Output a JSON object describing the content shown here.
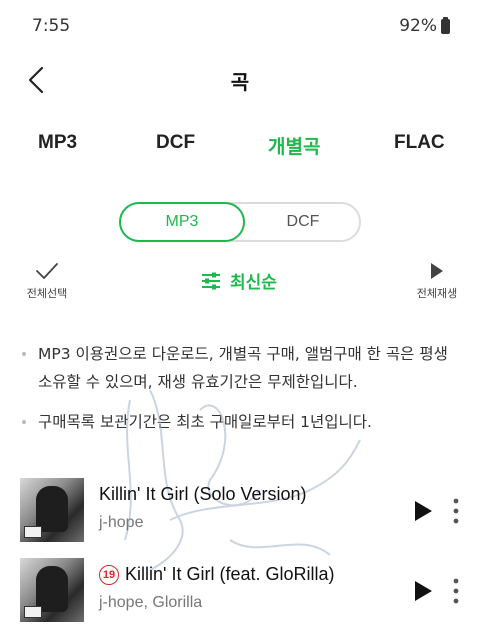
{
  "status_bar": {
    "time": "7:55",
    "battery": "92%"
  },
  "header": {
    "title": "곡"
  },
  "tabs": [
    {
      "label": "MP3",
      "active": false
    },
    {
      "label": "DCF",
      "active": false
    },
    {
      "label": "개별곡",
      "active": true
    },
    {
      "label": "FLAC",
      "active": false
    }
  ],
  "format_toggle": {
    "options": [
      "MP3",
      "DCF"
    ],
    "selected": "MP3"
  },
  "actions": {
    "select_all": "전체선택",
    "sort": "최신순",
    "play_all": "전체재생"
  },
  "notice": [
    "MP3 이용권으로 다운로드, 개별곡 구매, 앨범구매 한 곡은 평생 소유할 수 있으며, 재생 유효기간은 무제한입니다.",
    "구매목록 보관기간은 최초 구매일로부터 1년입니다."
  ],
  "songs": [
    {
      "title": "Killin' It Girl (Solo Version)",
      "artist": "j-hope",
      "age_badge": ""
    },
    {
      "title": "Killin' It Girl (feat. GloRilla)",
      "artist": "j-hope, Glorilla",
      "age_badge": "19"
    }
  ],
  "colors": {
    "accent": "#1fb84d",
    "age_badge": "#e0242a",
    "text": "#1a1a1a"
  }
}
